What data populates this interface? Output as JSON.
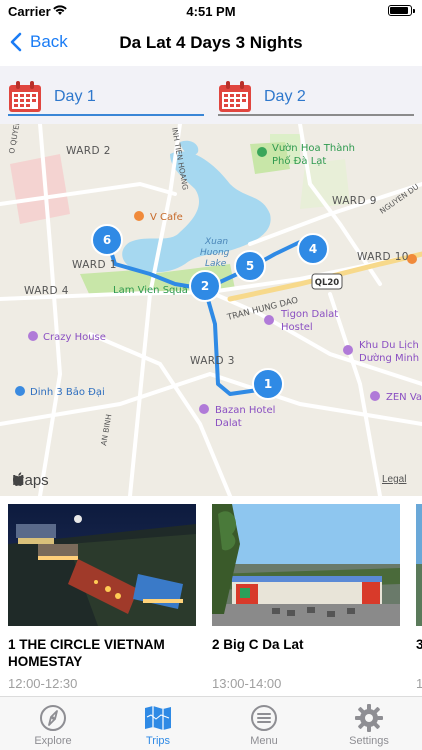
{
  "status_bar": {
    "carrier": "Carrier",
    "time": "4:51 PM"
  },
  "nav": {
    "back_label": "Back",
    "title": "Da Lat 4 Days 3 Nights"
  },
  "day_tabs": [
    {
      "label": "Day 1"
    },
    {
      "label": "Day 2"
    }
  ],
  "map": {
    "labels": {
      "ward2": "WARD 2",
      "ward1": "WARD 1",
      "ward4": "WARD 4",
      "ward3": "WARD 3",
      "ward9": "WARD 9",
      "ward10": "WARD 10",
      "vcafe": "V Cafe",
      "xuan": "Xuan",
      "huong": "Huong",
      "lake": "Lake",
      "lamvien": "Lam Vien Squa",
      "crazy": "Crazy House",
      "vuon1": "Vườn Hoa Thành",
      "vuon2": "Phố Đà Lạt",
      "tigon1": "Tigon Dalat",
      "tigon2": "Hostel",
      "khu1": "Khu Du Lịch",
      "khu2": "Dường Minh",
      "dinh": "Dinh 3 Bảo Đại",
      "bazan1": "Bazan Hotel",
      "bazan2": "Dalat",
      "zen": "ZEN Va",
      "ql20": "QL20",
      "tranhungdao": "TRAN HUNG DAO",
      "nguyendu": "NGUYEN DU",
      "oquyen": "O QUYEN",
      "tienhoang": "INH TIEN HOANG",
      "anbinh": "AN BINH"
    },
    "pins": [
      "1",
      "2",
      "4",
      "5",
      "6"
    ],
    "maps_label": "Maps",
    "legal": "Legal"
  },
  "cards": [
    {
      "title": "1 THE CIRCLE VIETNAM HOMESTAY",
      "time": "12:00-12:30"
    },
    {
      "title": "2 Big C Da Lat",
      "time": "13:00-14:00"
    },
    {
      "title": "3",
      "time": "1"
    }
  ],
  "tabbar": [
    {
      "label": "Explore",
      "icon": "compass-icon"
    },
    {
      "label": "Trips",
      "icon": "map-icon"
    },
    {
      "label": "Menu",
      "icon": "menu-icon"
    },
    {
      "label": "Settings",
      "icon": "gear-icon"
    }
  ],
  "colors": {
    "accent": "#2f8ae5",
    "route": "#2f8ae5",
    "calendar": "#e0463f",
    "water": "#a6d8f0",
    "park": "#c8e6a8"
  }
}
